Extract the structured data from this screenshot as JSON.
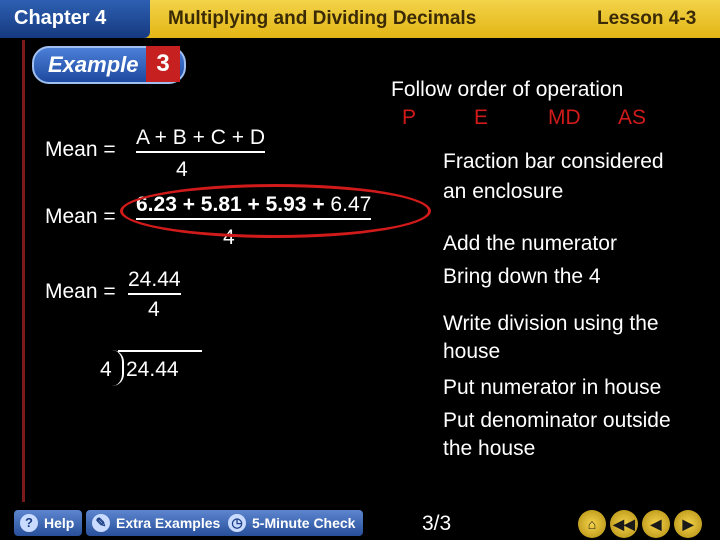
{
  "header": {
    "chapter": "Chapter 4",
    "title": "Multiplying and Dividing Decimals",
    "lesson": "Lesson 4-3"
  },
  "example": {
    "label": "Example",
    "number": "3"
  },
  "left": {
    "mean_label_1": "Mean =",
    "formula_num": "A + B + C + D",
    "formula_den": "4",
    "mean_label_2": "Mean =",
    "values_num_a": "6.23 + 5.81 + 5.93 +",
    "values_num_b": " 6.47",
    "values_den": "4",
    "mean_label_3": "Mean =",
    "sum_num": "24.44",
    "sum_den": "4",
    "ld_divisor": "4",
    "ld_dividend": "24.44"
  },
  "right": {
    "order_title": "Follow order of operation",
    "order_p": "P",
    "order_e": "E",
    "order_md": "MD",
    "order_as": "AS",
    "fraction_1": "Fraction bar considered",
    "fraction_2": "an enclosure",
    "add_num": "Add the numerator",
    "bring_down": "Bring down the 4",
    "write_div_1": "Write division using the",
    "write_div_2": "house",
    "put_num": "Put numerator in house",
    "put_den_1": "Put denominator outside",
    "put_den_2": "the house"
  },
  "footer": {
    "help": "Help",
    "extra": "Extra Examples",
    "check": "5-Minute Check",
    "page": "3/3"
  }
}
